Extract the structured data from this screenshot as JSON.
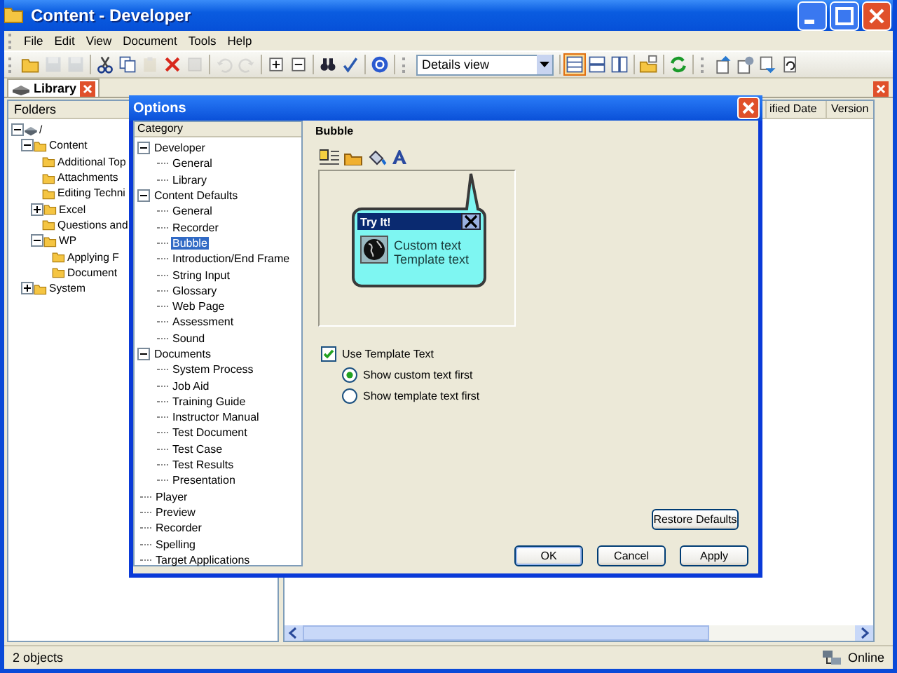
{
  "window": {
    "title": "Content - Developer"
  },
  "menu": [
    "File",
    "Edit",
    "View",
    "Document",
    "Tools",
    "Help"
  ],
  "toolbar": {
    "view_select": "Details view",
    "view_buttons": [
      {
        "selected": true
      },
      {
        "selected": false
      },
      {
        "selected": false
      }
    ]
  },
  "tab": {
    "label": "Library",
    "selected": true
  },
  "folders": {
    "header": "Folders",
    "tree": [
      {
        "label": "/",
        "expanded": true,
        "children": [
          {
            "label": "Content",
            "expanded": true,
            "children": [
              {
                "label": "Additional Top"
              },
              {
                "label": "Attachments"
              },
              {
                "label": "Editing Techni"
              },
              {
                "label": "Excel",
                "expanded": false
              },
              {
                "label": "Questions and"
              },
              {
                "label": "WP",
                "expanded": true,
                "children": [
                  {
                    "label": "Applying F"
                  },
                  {
                    "label": "Document"
                  }
                ]
              }
            ]
          },
          {
            "label": "System",
            "expanded": false
          }
        ]
      }
    ]
  },
  "list": {
    "columns": [
      "ified Date",
      "Version"
    ]
  },
  "status_bar": {
    "count": "2 objects",
    "connection": "Online"
  },
  "dialog": {
    "title": "Options",
    "category_header": "Category",
    "categories": [
      {
        "label": "Developer",
        "expanded": true,
        "selected": false,
        "children": [
          {
            "label": "General",
            "selected": false
          },
          {
            "label": "Library",
            "selected": false
          }
        ]
      },
      {
        "label": "Content Defaults",
        "expanded": true,
        "selected": false,
        "children": [
          {
            "label": "General",
            "selected": false
          },
          {
            "label": "Recorder",
            "selected": false
          },
          {
            "label": "Bubble",
            "selected": true
          },
          {
            "label": "Introduction/End Frame",
            "selected": false
          },
          {
            "label": "String Input",
            "selected": false
          },
          {
            "label": "Glossary",
            "selected": false
          },
          {
            "label": "Web Page",
            "selected": false
          },
          {
            "label": "Assessment",
            "selected": false
          },
          {
            "label": "Sound",
            "selected": false
          }
        ]
      },
      {
        "label": "Documents",
        "expanded": true,
        "selected": false,
        "children": [
          {
            "label": "System Process",
            "selected": false
          },
          {
            "label": "Job Aid",
            "selected": false
          },
          {
            "label": "Training Guide",
            "selected": false
          },
          {
            "label": "Instructor Manual",
            "selected": false
          },
          {
            "label": "Test Document",
            "selected": false
          },
          {
            "label": "Test Case",
            "selected": false
          },
          {
            "label": "Test Results",
            "selected": false
          },
          {
            "label": "Presentation",
            "selected": false
          }
        ]
      },
      {
        "label": "Player",
        "selected": false
      },
      {
        "label": "Preview",
        "selected": false
      },
      {
        "label": "Recorder",
        "selected": false
      },
      {
        "label": "Spelling",
        "selected": false
      },
      {
        "label": "Target Applications",
        "selected": false
      }
    ],
    "heading": "Bubble",
    "bubble": {
      "title": "Try It!",
      "lines": [
        "Custom text",
        "Template text"
      ]
    },
    "use_template": {
      "label": "Use Template Text",
      "checked": true
    },
    "radios": [
      {
        "label": "Show custom text first",
        "selected": true
      },
      {
        "label": "Show template text first",
        "selected": false
      }
    ],
    "restore": "Restore Defaults",
    "buttons": [
      "OK",
      "Cancel",
      "Apply"
    ]
  }
}
